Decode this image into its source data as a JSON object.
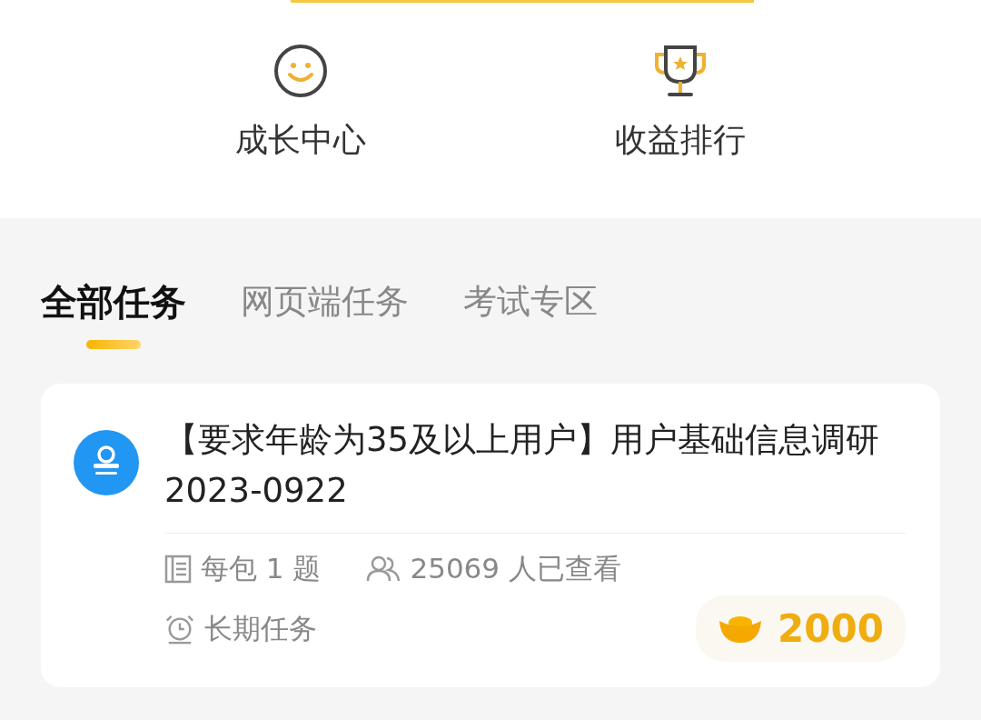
{
  "shortcuts": [
    {
      "kind": "smile",
      "label": "成长中心"
    },
    {
      "kind": "trophy",
      "label": "收益排行"
    }
  ],
  "tabs": [
    {
      "label": "全部任务",
      "selected": true
    },
    {
      "label": "网页端任务",
      "selected": false
    },
    {
      "label": "考试专区",
      "selected": false
    }
  ],
  "tasks": [
    {
      "title": "【要求年龄为35及以上用户】用户基础信息调研2023-0922",
      "questions": "每包 1 题",
      "viewers": "25069 人已查看",
      "duration": "长期任务",
      "reward": "2000"
    }
  ]
}
